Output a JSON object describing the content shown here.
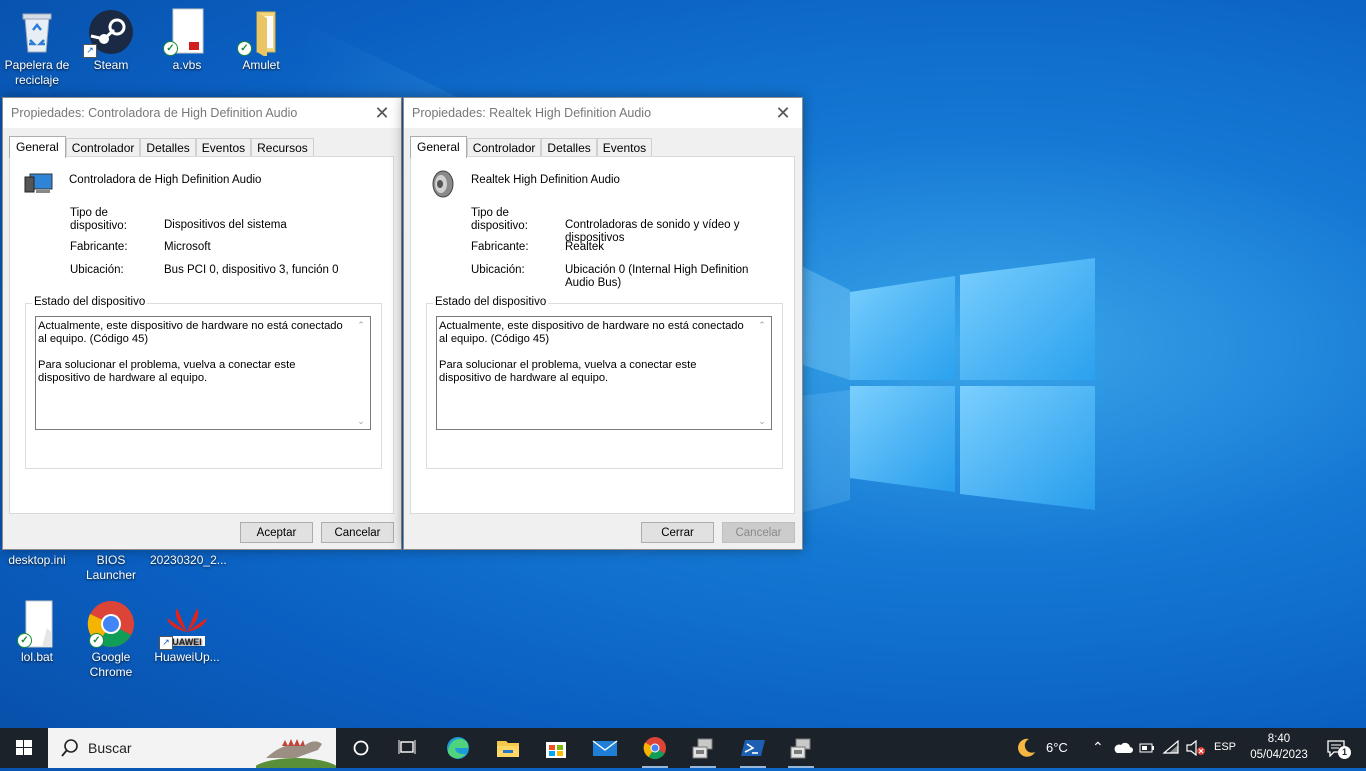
{
  "desktop": {
    "icons": [
      {
        "label": "Papelera de reciclaje",
        "icon": "recycle-bin-icon"
      },
      {
        "label": "Steam",
        "icon": "steam-icon"
      },
      {
        "label": "a.vbs",
        "icon": "script-file-icon"
      },
      {
        "label": "Amulet",
        "icon": "folder-icon"
      },
      {
        "label": "desktop.ini",
        "icon": "settings-file-icon"
      },
      {
        "label": "BIOS Launcher",
        "icon": "app-icon"
      },
      {
        "label": "20230320_2...",
        "icon": "file-icon"
      },
      {
        "label": "lol.bat",
        "icon": "batch-file-icon"
      },
      {
        "label": "Google Chrome",
        "icon": "chrome-icon"
      },
      {
        "label": "HuaweiUp...",
        "icon": "huawei-icon"
      }
    ]
  },
  "dialog1": {
    "title": "Propiedades: Controladora de High Definition Audio",
    "close": "✕",
    "tabs": [
      "General",
      "Controlador",
      "Detalles",
      "Eventos",
      "Recursos"
    ],
    "device_name": "Controladora de High Definition Audio",
    "type_label": "Tipo de dispositivo:",
    "type_value": "Dispositivos del sistema",
    "maker_label": "Fabricante:",
    "maker_value": "Microsoft",
    "location_label": "Ubicación:",
    "location_value": "Bus PCI 0, dispositivo 3, función 0",
    "status_legend": "Estado del dispositivo",
    "status_p1": "Actualmente, este dispositivo de hardware no está conectado al equipo. (Código 45)",
    "status_p2": "Para solucionar el problema, vuelva a conectar este dispositivo de hardware al equipo.",
    "ok": "Aceptar",
    "cancel": "Cancelar"
  },
  "dialog2": {
    "title": "Propiedades: Realtek High Definition Audio",
    "close": "✕",
    "tabs": [
      "General",
      "Controlador",
      "Detalles",
      "Eventos"
    ],
    "device_name": "Realtek High Definition Audio",
    "type_label": "Tipo de dispositivo:",
    "type_value": "Controladoras de sonido y vídeo y dispositivos",
    "maker_label": "Fabricante:",
    "maker_value": "Realtek",
    "location_label": "Ubicación:",
    "location_value": "Ubicación 0 (Internal High Definition Audio Bus)",
    "status_legend": "Estado del dispositivo",
    "status_p1": "Actualmente, este dispositivo de hardware no está conectado al equipo. (Código 45)",
    "status_p2": "Para solucionar el problema, vuelva a conectar este dispositivo de hardware al equipo.",
    "close_btn": "Cerrar",
    "cancel": "Cancelar"
  },
  "taskbar": {
    "search_placeholder": "Buscar",
    "pinned": [
      "cortana-icon",
      "task-view-icon",
      "edge-icon",
      "file-explorer-icon",
      "store-icon",
      "mail-icon",
      "chrome-icon",
      "device-manager-icon",
      "powershell-icon",
      "device-manager-icon"
    ],
    "weather": "6°C",
    "language": "ESP",
    "time": "8:40",
    "date": "05/04/2023",
    "notifications": "1"
  },
  "colors": {
    "accent": "#0a64c8",
    "taskbar": "#1c2229"
  }
}
